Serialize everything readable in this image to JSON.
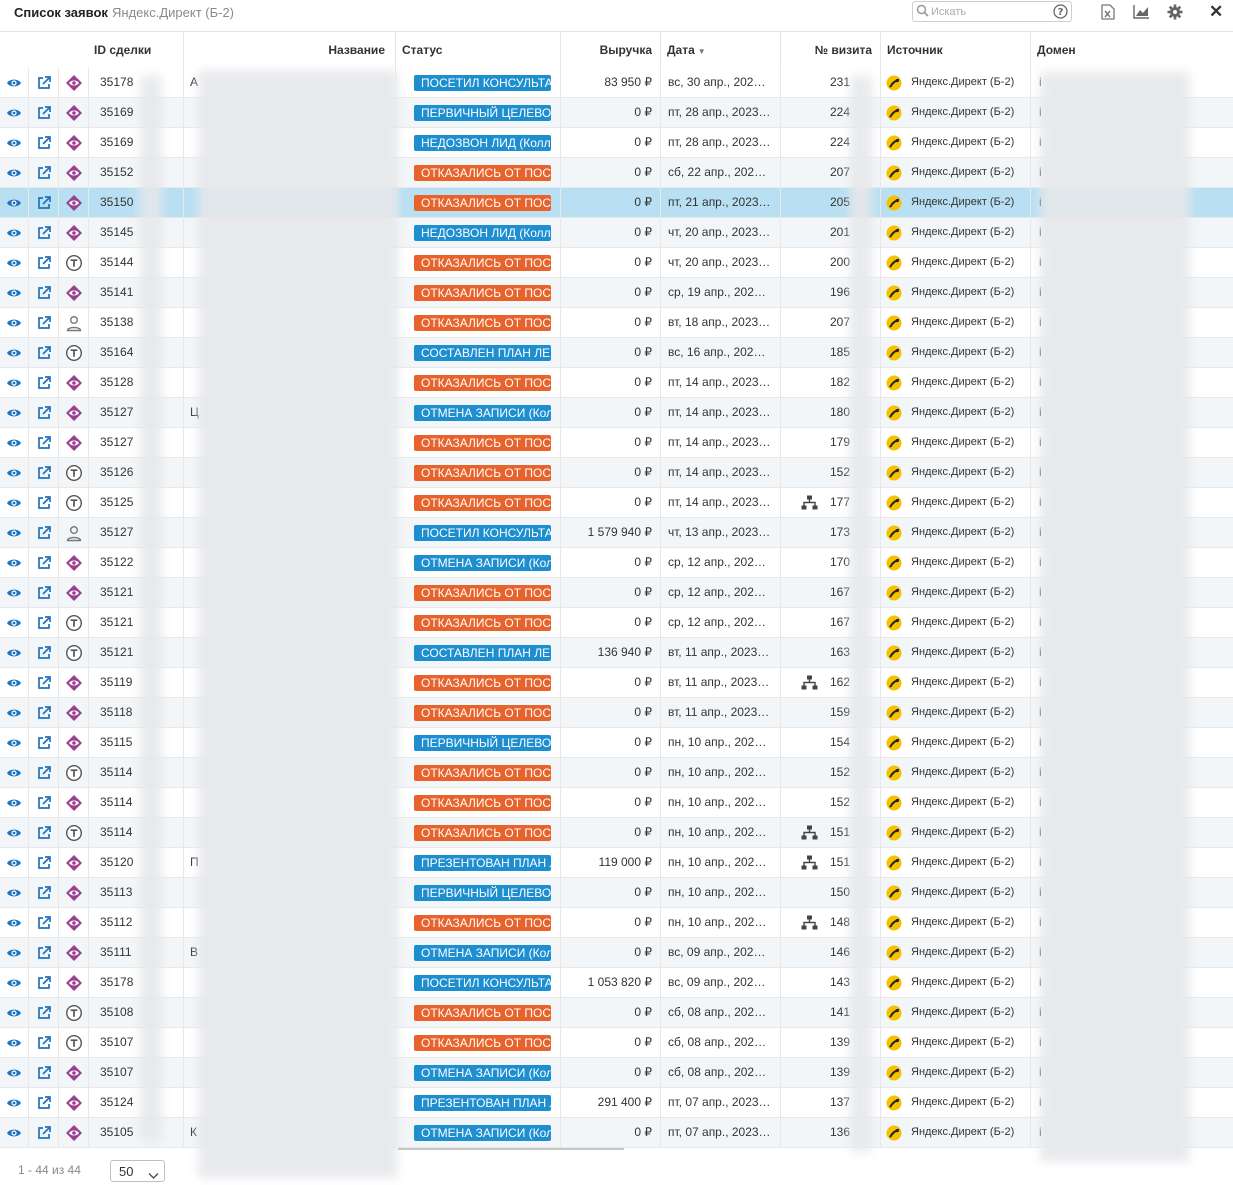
{
  "app": {
    "title": "Список заявок",
    "subtitle": "Яндекс.Директ (Б-2)",
    "search_placeholder": "Искать",
    "toolbar_icons": [
      "excel-export-icon",
      "chart-icon",
      "gear-icon",
      "close-icon"
    ],
    "close_label": "✕"
  },
  "columns": {
    "id": "ID сделки",
    "name": "Название",
    "status": "Статус",
    "revenue": "Выручка",
    "date": "Дата",
    "date_sort": "▼",
    "visit": "№ визита",
    "source": "Источник",
    "domain": "Домен"
  },
  "status_colors": {
    "blue": "#1d8fd1",
    "orange": "#e8632b",
    "selected_row": "#b9dff2",
    "icon_purple": "#9b3f8e",
    "icon_blue": "#1e73be"
  },
  "rows": [
    {
      "icon": "lead-icon",
      "id": "35178",
      "name": "А",
      "status": "ПОСЕТИЛ КОНСУЛЬТАЦИЮ",
      "color": "blue",
      "revenue": "83 950 ₽",
      "date": "вс, 30 апр., 202…",
      "net": false,
      "visit": "231",
      "source": "Яндекс.Директ (Б-2)",
      "domain": "i"
    },
    {
      "icon": "lead-icon",
      "id": "35169",
      "name": "",
      "status": "ПЕРВИЧНЫЙ ЦЕЛЕВОЙ",
      "color": "blue",
      "revenue": "0 ₽",
      "date": "пт, 28 апр., 2023…",
      "net": false,
      "visit": "224",
      "source": "Яндекс.Директ (Б-2)",
      "domain": "i"
    },
    {
      "icon": "lead-icon",
      "id": "35169",
      "name": "",
      "status": "НЕДОЗВОН ЛИД (Колл-центр)",
      "color": "blue",
      "revenue": "0 ₽",
      "date": "пт, 28 апр., 2023…",
      "net": false,
      "visit": "224",
      "source": "Яндекс.Директ (Б-2)",
      "domain": "i"
    },
    {
      "icon": "lead-icon",
      "id": "35152",
      "name": "",
      "status": "ОТКАЗАЛИСЬ ОТ ПОСЕЩЕНИЯ",
      "color": "orange",
      "revenue": "0 ₽",
      "date": "сб, 22 апр., 202…",
      "net": false,
      "visit": "207",
      "source": "Яндекс.Директ (Б-2)",
      "domain": "i"
    },
    {
      "icon": "lead-icon",
      "id": "35150",
      "name": "",
      "status": "ОТКАЗАЛИСЬ ОТ ПОСЕЩЕНИЯ",
      "color": "orange",
      "revenue": "0 ₽",
      "date": "пт, 21 апр., 2023…",
      "net": false,
      "visit": "205",
      "source": "Яндекс.Директ (Б-2)",
      "domain": "i",
      "selected": true
    },
    {
      "icon": "lead-icon",
      "id": "35145",
      "name": "",
      "status": "НЕДОЗВОН ЛИД (Колл-центр)",
      "color": "blue",
      "revenue": "0 ₽",
      "date": "чт, 20 апр., 2023…",
      "net": false,
      "visit": "201",
      "source": "Яндекс.Директ (Б-2)",
      "domain": "i"
    },
    {
      "icon": "call-icon",
      "id": "35144",
      "name": "",
      "status": "ОТКАЗАЛИСЬ ОТ ПОСЕЩЕНИЯ",
      "color": "orange",
      "revenue": "0 ₽",
      "date": "чт, 20 апр., 2023…",
      "net": false,
      "visit": "200",
      "source": "Яндекс.Директ (Б-2)",
      "domain": "i"
    },
    {
      "icon": "lead-icon",
      "id": "35141",
      "name": "",
      "status": "ОТКАЗАЛИСЬ ОТ ПОСЕЩЕНИЯ",
      "color": "orange",
      "revenue": "0 ₽",
      "date": "ср, 19 апр., 202…",
      "net": false,
      "visit": "196",
      "source": "Яндекс.Директ (Б-2)",
      "domain": "i"
    },
    {
      "icon": "user-icon",
      "id": "35138",
      "name": "",
      "status": "ОТКАЗАЛИСЬ ОТ ПОСЕЩЕНИЯ",
      "color": "orange",
      "revenue": "0 ₽",
      "date": "вт, 18 апр., 2023…",
      "net": false,
      "visit": "207",
      "source": "Яндекс.Директ (Б-2)",
      "domain": "i"
    },
    {
      "icon": "call-icon",
      "id": "35164",
      "name": "",
      "status": "СОСТАВЛЕН ПЛАН ЛЕЧЕНИЯ",
      "color": "blue",
      "revenue": "0 ₽",
      "date": "вс, 16 апр., 202…",
      "net": false,
      "visit": "185",
      "source": "Яндекс.Директ (Б-2)",
      "domain": "i"
    },
    {
      "icon": "lead-icon",
      "id": "35128",
      "name": "",
      "status": "ОТКАЗАЛИСЬ ОТ ПОСЕЩЕНИЯ",
      "color": "orange",
      "revenue": "0 ₽",
      "date": "пт, 14 апр., 2023…",
      "net": false,
      "visit": "182",
      "source": "Яндекс.Директ (Б-2)",
      "domain": "i"
    },
    {
      "icon": "lead-icon",
      "id": "35127",
      "name": "Ц",
      "status": "ОТМЕНА ЗАПИСИ (Колл-центр)",
      "color": "blue",
      "revenue": "0 ₽",
      "date": "пт, 14 апр., 2023…",
      "net": false,
      "visit": "180",
      "source": "Яндекс.Директ (Б-2)",
      "domain": "i"
    },
    {
      "icon": "lead-icon",
      "id": "35127",
      "name": "",
      "status": "ОТКАЗАЛИСЬ ОТ ПОСЕЩЕНИЯ",
      "color": "orange",
      "revenue": "0 ₽",
      "date": "пт, 14 апр., 2023…",
      "net": false,
      "visit": "179",
      "source": "Яндекс.Директ (Б-2)",
      "domain": "i"
    },
    {
      "icon": "call-icon",
      "id": "35126",
      "name": "",
      "status": "ОТКАЗАЛИСЬ ОТ ПОСЕЩЕНИЯ",
      "color": "orange",
      "revenue": "0 ₽",
      "date": "пт, 14 апр., 2023…",
      "net": false,
      "visit": "152",
      "source": "Яндекс.Директ (Б-2)",
      "domain": "i"
    },
    {
      "icon": "call-icon",
      "id": "35125",
      "name": "",
      "status": "ОТКАЗАЛИСЬ ОТ ПОСЕЩЕНИЯ",
      "color": "orange",
      "revenue": "0 ₽",
      "date": "пт, 14 апр., 2023…",
      "net": true,
      "visit": "177",
      "source": "Яндекс.Директ (Б-2)",
      "domain": "i"
    },
    {
      "icon": "user-icon",
      "id": "35127",
      "name": "",
      "status": "ПОСЕТИЛ КОНСУЛЬТАЦИЮ",
      "color": "blue",
      "revenue": "1 579 940 ₽",
      "date": "чт, 13 апр., 2023…",
      "net": false,
      "visit": "173",
      "source": "Яндекс.Директ (Б-2)",
      "domain": "i"
    },
    {
      "icon": "lead-icon",
      "id": "35122",
      "name": "",
      "status": "ОТМЕНА ЗАПИСИ (Колл-центр)",
      "color": "blue",
      "revenue": "0 ₽",
      "date": "ср, 12 апр., 202…",
      "net": false,
      "visit": "170",
      "source": "Яндекс.Директ (Б-2)",
      "domain": "i"
    },
    {
      "icon": "lead-icon",
      "id": "35121",
      "name": "",
      "status": "ОТКАЗАЛИСЬ ОТ ПОСЕЩЕНИЯ",
      "color": "orange",
      "revenue": "0 ₽",
      "date": "ср, 12 апр., 202…",
      "net": false,
      "visit": "167",
      "source": "Яндекс.Директ (Б-2)",
      "domain": "i"
    },
    {
      "icon": "call-icon",
      "id": "35121",
      "name": "",
      "status": "ОТКАЗАЛИСЬ ОТ ПОСЕЩЕНИЯ",
      "color": "orange",
      "revenue": "0 ₽",
      "date": "ср, 12 апр., 202…",
      "net": false,
      "visit": "167",
      "source": "Яндекс.Директ (Б-2)",
      "domain": "i"
    },
    {
      "icon": "call-icon",
      "id": "35121",
      "name": "",
      "status": "СОСТАВЛЕН ПЛАН ЛЕЧЕНИЯ",
      "color": "blue",
      "revenue": "136 940 ₽",
      "date": "вт, 11 апр., 2023…",
      "net": false,
      "visit": "163",
      "source": "Яндекс.Директ (Б-2)",
      "domain": "i"
    },
    {
      "icon": "lead-icon",
      "id": "35119",
      "name": "",
      "status": "ОТКАЗАЛИСЬ ОТ ПОСЕЩЕНИЯ",
      "color": "orange",
      "revenue": "0 ₽",
      "date": "вт, 11 апр., 2023…",
      "net": true,
      "visit": "162",
      "source": "Яндекс.Директ (Б-2)",
      "domain": "i"
    },
    {
      "icon": "lead-icon",
      "id": "35118",
      "name": "",
      "status": "ОТКАЗАЛИСЬ ОТ ПОСЕЩЕНИЯ",
      "color": "orange",
      "revenue": "0 ₽",
      "date": "вт, 11 апр., 2023…",
      "net": false,
      "visit": "159",
      "source": "Яндекс.Директ (Б-2)",
      "domain": "i"
    },
    {
      "icon": "lead-icon",
      "id": "35115",
      "name": "",
      "status": "ПЕРВИЧНЫЙ ЦЕЛЕВОЙ",
      "color": "blue",
      "revenue": "0 ₽",
      "date": "пн, 10 апр., 202…",
      "net": false,
      "visit": "154",
      "source": "Яндекс.Директ (Б-2)",
      "domain": "i"
    },
    {
      "icon": "call-icon",
      "id": "35114",
      "name": "",
      "status": "ОТКАЗАЛИСЬ ОТ ПОСЕЩЕНИЯ",
      "color": "orange",
      "revenue": "0 ₽",
      "date": "пн, 10 апр., 202…",
      "net": false,
      "visit": "152",
      "source": "Яндекс.Директ (Б-2)",
      "domain": "i"
    },
    {
      "icon": "lead-icon",
      "id": "35114",
      "name": "",
      "status": "ОТКАЗАЛИСЬ ОТ ПОСЕЩЕНИЯ",
      "color": "orange",
      "revenue": "0 ₽",
      "date": "пн, 10 апр., 202…",
      "net": false,
      "visit": "152",
      "source": "Яндекс.Директ (Б-2)",
      "domain": "i"
    },
    {
      "icon": "call-icon",
      "id": "35114",
      "name": "",
      "status": "ОТКАЗАЛИСЬ ОТ ПОСЕЩЕНИЯ",
      "color": "orange",
      "revenue": "0 ₽",
      "date": "пн, 10 апр., 202…",
      "net": true,
      "visit": "151",
      "source": "Яндекс.Директ (Б-2)",
      "domain": "i"
    },
    {
      "icon": "lead-icon",
      "id": "35120",
      "name": "П",
      "status": "ПРЕЗЕНТОВАН ПЛАН ЛЕЧЕНИЯ",
      "color": "blue",
      "revenue": "119 000 ₽",
      "date": "пн, 10 апр., 202…",
      "net": true,
      "visit": "151",
      "source": "Яндекс.Директ (Б-2)",
      "domain": "i"
    },
    {
      "icon": "lead-icon",
      "id": "35113",
      "name": "",
      "status": "ПЕРВИЧНЫЙ ЦЕЛЕВОЙ",
      "color": "blue",
      "revenue": "0 ₽",
      "date": "пн, 10 апр., 202…",
      "net": false,
      "visit": "150",
      "source": "Яндекс.Директ (Б-2)",
      "domain": "i"
    },
    {
      "icon": "lead-icon",
      "id": "35112",
      "name": "",
      "status": "ОТКАЗАЛИСЬ ОТ ПОСЕЩЕНИЯ",
      "color": "orange",
      "revenue": "0 ₽",
      "date": "пн, 10 апр., 202…",
      "net": true,
      "visit": "148",
      "source": "Яндекс.Директ (Б-2)",
      "domain": "i"
    },
    {
      "icon": "lead-icon",
      "id": "35111",
      "name": "В",
      "status": "ОТМЕНА ЗАПИСИ (Колл-центр)",
      "color": "blue",
      "revenue": "0 ₽",
      "date": "вс, 09 апр., 202…",
      "net": false,
      "visit": "146",
      "source": "Яндекс.Директ (Б-2)",
      "domain": "i"
    },
    {
      "icon": "lead-icon",
      "id": "35178",
      "name": "",
      "status": "ПОСЕТИЛ КОНСУЛЬТАЦИЮ",
      "color": "blue",
      "revenue": "1 053 820 ₽",
      "date": "вс, 09 апр., 202…",
      "net": false,
      "visit": "143",
      "source": "Яндекс.Директ (Б-2)",
      "domain": "i"
    },
    {
      "icon": "call-icon",
      "id": "35108",
      "name": "",
      "status": "ОТКАЗАЛИСЬ ОТ ПОСЕЩЕНИЯ",
      "color": "orange",
      "revenue": "0 ₽",
      "date": "сб, 08 апр., 202…",
      "net": false,
      "visit": "141",
      "source": "Яндекс.Директ (Б-2)",
      "domain": "i"
    },
    {
      "icon": "call-icon",
      "id": "35107",
      "name": "",
      "status": "ОТКАЗАЛИСЬ ОТ ПОСЕЩЕНИЯ",
      "color": "orange",
      "revenue": "0 ₽",
      "date": "сб, 08 апр., 202…",
      "net": false,
      "visit": "139",
      "source": "Яндекс.Директ (Б-2)",
      "domain": "i"
    },
    {
      "icon": "lead-icon",
      "id": "35107",
      "name": "",
      "status": "ОТМЕНА ЗАПИСИ (Колл-центр)",
      "color": "blue",
      "revenue": "0 ₽",
      "date": "сб, 08 апр., 202…",
      "net": false,
      "visit": "139",
      "source": "Яндекс.Директ (Б-2)",
      "domain": "i"
    },
    {
      "icon": "lead-icon",
      "id": "35124",
      "name": "",
      "status": "ПРЕЗЕНТОВАН ПЛАН ЛЕЧЕНИЯ",
      "color": "blue",
      "revenue": "291 400 ₽",
      "date": "пт, 07 апр., 2023…",
      "net": false,
      "visit": "137",
      "source": "Яндекс.Директ (Б-2)",
      "domain": "i"
    },
    {
      "icon": "lead-icon",
      "id": "35105",
      "name": "К",
      "status": "ОТМЕНА ЗАПИСИ (Колл-центр)",
      "color": "blue",
      "revenue": "0 ₽",
      "date": "пт, 07 апр., 2023…",
      "net": false,
      "visit": "136",
      "source": "Яндекс.Директ (Б-2)",
      "domain": "i"
    }
  ],
  "footer": {
    "range": "1 - 44 из 44",
    "page_size": "50"
  }
}
